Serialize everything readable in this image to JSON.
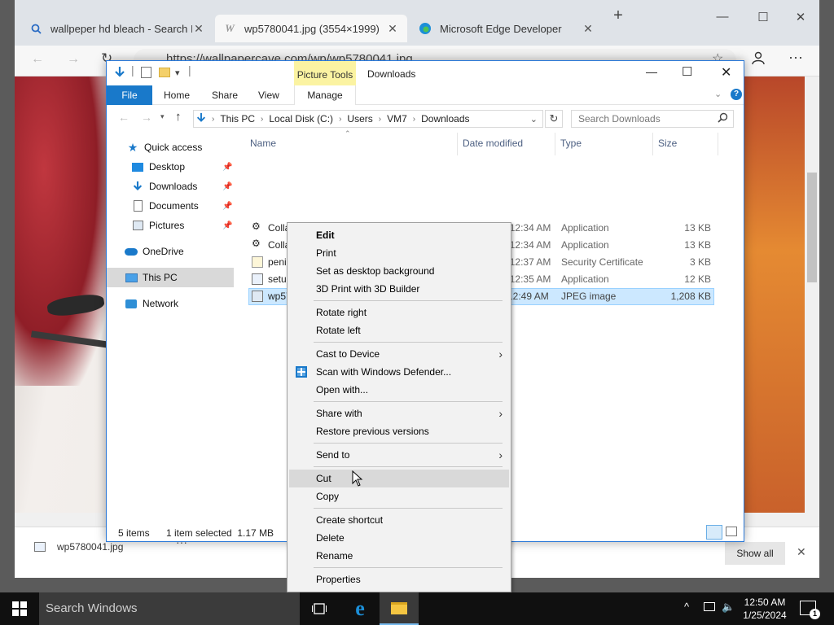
{
  "browser": {
    "tabs": [
      {
        "title": "wallpeper hd bleach - Search Im",
        "icon": "search-icon"
      },
      {
        "title": "wp5780041.jpg (3554×1999)",
        "icon": "wallpapercave-icon"
      },
      {
        "title": "Microsoft Edge Developer",
        "icon": "edge-icon"
      }
    ],
    "url": "https://wallpapercave.com/wp/wp5780041.jpg",
    "download": {
      "filename": "wp5780041.jpg",
      "show_all": "Show all"
    }
  },
  "explorer": {
    "title": "Downloads",
    "contextual_tab_group": "Picture Tools",
    "ribbon_tabs": [
      "File",
      "Home",
      "Share",
      "View",
      "Manage"
    ],
    "breadcrumb": [
      "This PC",
      "Local Disk (C:)",
      "Users",
      "VM7",
      "Downloads"
    ],
    "search_placeholder": "Search Downloads",
    "nav": {
      "quick_access": "Quick access",
      "pinned": [
        "Desktop",
        "Downloads",
        "Documents",
        "Pictures"
      ],
      "onedrive": "OneDrive",
      "this_pc": "This PC",
      "network": "Network"
    },
    "columns": [
      "Name",
      "Date modified",
      "Type",
      "Size"
    ],
    "files": [
      {
        "name": "CollabnetInstaller",
        "date": "1/25/2024 12:34 AM",
        "type": "Application",
        "size": "13 KB"
      },
      {
        "name": "CollabnetInstaller_legacy",
        "date": "1/25/2024 12:34 AM",
        "type": "Application",
        "size": "13 KB"
      },
      {
        "name": "penis",
        "date": "1/25/2024 12:37 AM",
        "type": "Security Certificate",
        "size": "3 KB"
      },
      {
        "name": "setupcert",
        "date": "1/25/2024 12:35 AM",
        "type": "Application",
        "size": "12 KB"
      },
      {
        "name": "wp57",
        "date": "12:49 AM",
        "type": "JPEG image",
        "size": "1,208 KB"
      }
    ],
    "status": {
      "items": "5 items",
      "selected": "1 item selected  1.17 MB"
    }
  },
  "context_menu": {
    "groups": [
      [
        "Edit",
        "Print",
        "Set as desktop background",
        "3D Print with 3D Builder"
      ],
      [
        "Rotate right",
        "Rotate left"
      ],
      [
        "Cast to Device",
        "Scan with Windows Defender...",
        "Open with..."
      ],
      [
        "Share with",
        "Restore previous versions"
      ],
      [
        "Send to"
      ],
      [
        "Cut",
        "Copy"
      ],
      [
        "Create shortcut",
        "Delete",
        "Rename"
      ],
      [
        "Properties"
      ]
    ]
  },
  "taskbar": {
    "search_placeholder": "Search Windows",
    "time": "12:50 AM",
    "date": "1/25/2024",
    "notification_count": "1"
  },
  "colors": {
    "accent": "#1979ca",
    "selection": "#cce8ff",
    "menu_bg": "#f2f2f2",
    "taskbar": "#101010"
  }
}
